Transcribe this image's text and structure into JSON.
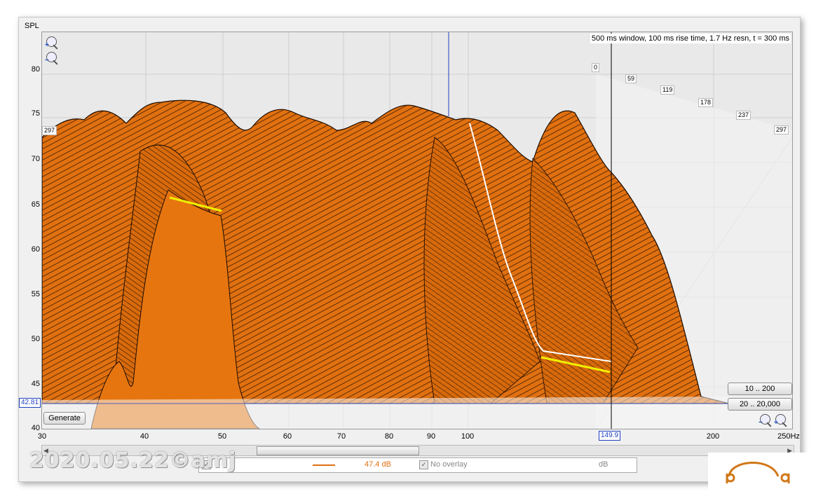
{
  "window": {
    "y_axis_title": "SPL",
    "y_ticks": [
      "80",
      "75",
      "70",
      "65",
      "60",
      "55",
      "50",
      "45",
      "40"
    ],
    "x_ticks": [
      "30",
      "40",
      "50",
      "60",
      "70",
      "80",
      "90",
      "100",
      "200",
      "250Hz"
    ],
    "cursor_y_value": "42.81",
    "cursor_x_value": "149.9",
    "info_text": "500 ms window, 100 ms rise time,  1.7 Hz resn, t = 300 ms",
    "time_slice_labels": [
      "0",
      "59",
      "119",
      "178",
      "237",
      "297"
    ],
    "left_slice_label": "297",
    "generate_label": "Generate",
    "range_buttons": [
      "10 .. 200",
      "20 .. 20,000"
    ]
  },
  "icons": {
    "zoom_in": "zoom-in-icon",
    "zoom_out": "zoom-out-icon",
    "brand_logo": "headphones-logo"
  },
  "watermark": "2020.05.22©amj",
  "legend": {
    "value": "47.4 dB",
    "overlay_label": "No overlay",
    "overlay_unit": "dB"
  },
  "colors": {
    "surface_fill": "#e07010",
    "surface_lines": "#1a0a00",
    "highlight": "#f0f000",
    "cursor_line": "#2040c0",
    "logo": "#d07818"
  }
}
